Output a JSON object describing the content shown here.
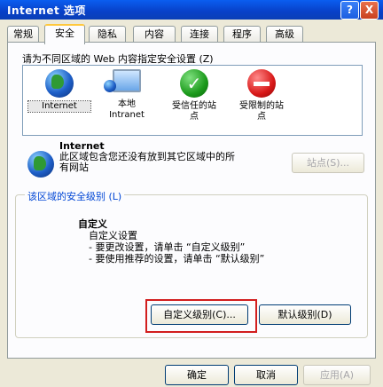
{
  "window": {
    "title": "Internet 选项"
  },
  "titlebar_buttons": {
    "help": "?",
    "close": "X"
  },
  "tabs": [
    {
      "label": "常规",
      "active": false
    },
    {
      "label": "安全",
      "active": true
    },
    {
      "label": "隐私",
      "active": false
    },
    {
      "label": "内容",
      "active": false
    },
    {
      "label": "连接",
      "active": false
    },
    {
      "label": "程序",
      "active": false
    },
    {
      "label": "高级",
      "active": false
    }
  ],
  "zones": {
    "label": "请为不同区域的 Web 内容指定安全设置 (Z)",
    "items": [
      {
        "label": "Internet",
        "icon": "globe-icon",
        "selected": true
      },
      {
        "label": "本地\nIntranet",
        "icon": "intranet-icon",
        "selected": false
      },
      {
        "label": "受信任的站\n点",
        "icon": "trusted-check-icon",
        "selected": false
      },
      {
        "label": "受限制的站\n点",
        "icon": "restricted-icon",
        "selected": false
      }
    ]
  },
  "selected_zone": {
    "name": "Internet",
    "description": "此区域包含您还没有放到其它区域中的所有网站",
    "sites_button": "站点(S)..."
  },
  "security_level": {
    "group_label": "该区域的安全级别 (L)",
    "title": "自定义",
    "lines": [
      "自定义设置",
      "- 要更改设置，请单击 “自定义级别”",
      "- 要使用推荐的设置，请单击 “默认级别”"
    ],
    "custom_button": "自定义级别(C)...",
    "default_button": "默认级别(D)"
  },
  "footer": {
    "ok": "确定",
    "cancel": "取消",
    "apply": "应用(A)"
  },
  "colors": {
    "highlight_box": "#d21e1e",
    "title_bar": "#0840c8"
  }
}
